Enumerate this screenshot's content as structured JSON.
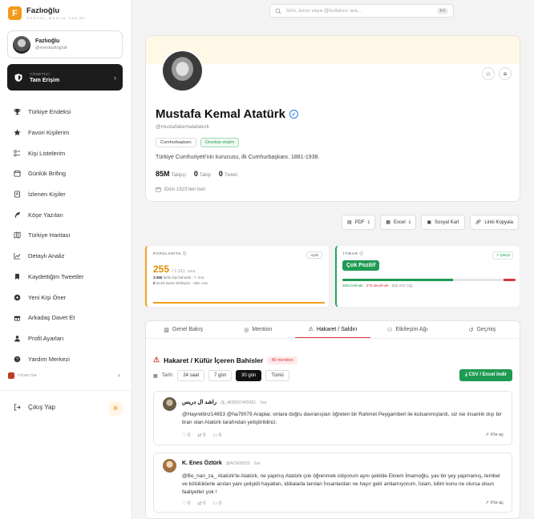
{
  "brand": {
    "name": "Fazlıoğlu",
    "subtitle": "SOSYAL MEDYA TAKİBİ",
    "logo_letter": "F"
  },
  "search": {
    "placeholder": "İsim, konu veya @kullanıcı ara...",
    "shortcut": "⌘K"
  },
  "user": {
    "name": "Fazlıoğlu",
    "handle": "@erenfazlioglutr"
  },
  "admin": {
    "role": "YÖNETİCİ",
    "access": "Tam Erişim"
  },
  "nav": [
    {
      "label": "Türkiye Endeksi",
      "icon": "trophy-icon"
    },
    {
      "label": "Favori Kişilerim",
      "icon": "star-icon"
    },
    {
      "label": "Kişi Listelerim",
      "icon": "list-icon"
    },
    {
      "label": "Günlük Brifing",
      "icon": "calendar-icon"
    },
    {
      "label": "İzlenen Kişiler",
      "icon": "book-icon"
    },
    {
      "label": "Köşe Yazıları",
      "icon": "feather-icon"
    },
    {
      "label": "Türkiye Haritası",
      "icon": "map-icon"
    },
    {
      "label": "Detaylı Analiz",
      "icon": "chart-icon"
    },
    {
      "label": "Kaydettiğim Tweetler",
      "icon": "bookmark-icon"
    },
    {
      "label": "Yeni Kişi Öner",
      "icon": "plus-circle-icon"
    },
    {
      "label": "Arkadaş Davet Et",
      "icon": "gift-icon"
    },
    {
      "label": "Profil Ayarları",
      "icon": "user-icon"
    },
    {
      "label": "Yardım Merkezi",
      "icon": "help-icon"
    }
  ],
  "yonetim": "YÖNETİM",
  "logout": "Çıkış Yap",
  "profile": {
    "name": "Mustafa Kemal Atatürk",
    "handle": "@mustafakemalataturk",
    "tags": [
      "Cumhurbaşkanı",
      "Ücretsiz erişim"
    ],
    "bio": "Türkiye Cumhuriyeti'nin kurucusu, ilk Cumhurbaşkanı. 1881-1938.",
    "followers": "85M",
    "followers_label": "Takipçi",
    "following": "0",
    "following_label": "Takip",
    "tweets": "0",
    "tweets_label": "Tweet",
    "joined": "Ekim 1923'den beri"
  },
  "actions": [
    "PDF",
    "Excel",
    "Sosyal Kart",
    "Linki Kopyala"
  ],
  "popularity": {
    "title": "POPÜLARİTE",
    "period": "Aylık",
    "value": "255",
    "of": "/ 1.311. sıra",
    "line1_num": "3.085",
    "line1_text": "farklı kişi bahsetti · 7. sıra",
    "line2_num": "0",
    "line2_text": "kendi tweet etkileşimi · 656. sıra"
  },
  "reputation": {
    "title": "İTİBAR",
    "trend": "↗ İyileşti",
    "sentiment": "Çok Pozitif",
    "positive_fraction": 0.64,
    "negative_fraction": 0.07,
    "positive_text": "3064 lehinde",
    "negative_text": "375 aleyhinde",
    "neutral_text": "826 nötr (7g)"
  },
  "tabs": [
    "Genel Bakış",
    "Mention",
    "Hakaret / Saldırı",
    "Etkileşim Ağı",
    "Geçmiş"
  ],
  "section": {
    "title": "Hakaret / Küfür İçeren Bahisler",
    "count": "49 mention",
    "date_label": "Tarih:",
    "filters": [
      "24 saat",
      "7 gün",
      "30 gün",
      "Tümü"
    ],
    "csv": "CSV / Excel indir"
  },
  "posts": [
    {
      "author": "راشد ال دريس",
      "handle": "@_4836507465851",
      "time": "1sa",
      "text": "@Hayrettinz14653 @ha79079 Araplar, onlara doğru davranışları öğreten bir Rahmet Peygamberi ile kutsanmışlardı, siz ise insanlık dışı bir tiran olan Atatürk tarafından yetiştirildiniz.",
      "likes": "0",
      "retweets": "0",
      "replies": "0",
      "link": "X'te aç"
    },
    {
      "author": "K. Enes Öztürk",
      "handle": "@AOS05523",
      "time": "2sa",
      "text": "@Bo_nan_za_ Atatürk'te Atatürk, ne yapmış Atatürk çok öğrenmek istiyorum aynı şekilde Ekrem İmamoğlu, yav bir şey yapmamış, tembel ve kötülüklerle anılan yani çelişkili hayatları, iddialarla tanılan İnsanlardan ne hayır gelir amlamıyorum, İslam, bilim konu ne olursa olsun faaliyetler yok !",
      "likes": "0",
      "retweets": "0",
      "replies": "0",
      "link": "X'te aç"
    }
  ],
  "colors": {
    "accent": "#f29a1b",
    "positive": "#1f9a52",
    "negative": "#d9363e",
    "verified": "#2a7be4"
  }
}
